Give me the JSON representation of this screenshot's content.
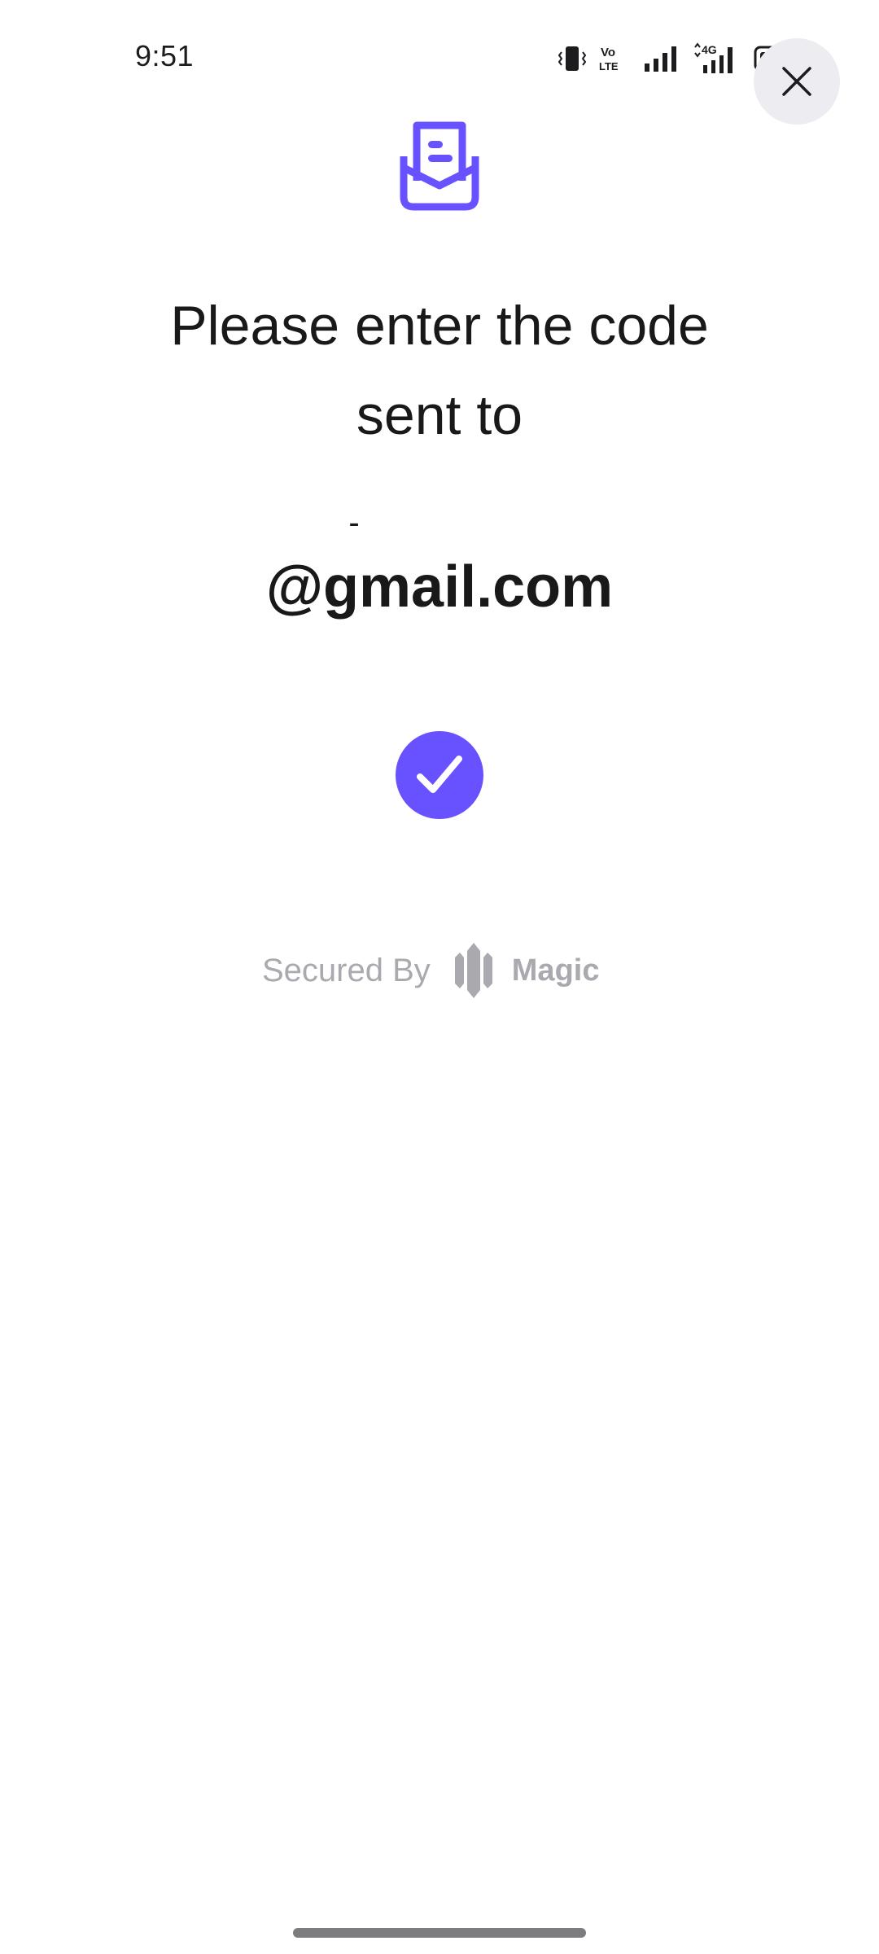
{
  "status_bar": {
    "time": "9:51",
    "icons": [
      "vibrate-icon",
      "volte-icon",
      "signal-icon",
      "4g-signal-icon",
      "battery-icon"
    ],
    "volte_label": "Vo LTE",
    "network_label": "4G"
  },
  "dialog": {
    "close_icon": "close-icon",
    "envelope_icon": "open-envelope-icon",
    "heading_line1": "Please enter the code",
    "heading_line2": "sent to",
    "email_local": "-",
    "email_domain": "@gmail.com",
    "status_icon": "check-circle-icon"
  },
  "footer": {
    "secured_label": "Secured By",
    "brand_icon": "magic-logo-icon",
    "brand_name": "Magic"
  },
  "colors": {
    "accent": "#6851ff",
    "text": "#19191a",
    "muted": "#a9a9af",
    "close_bg": "#ececf1"
  }
}
